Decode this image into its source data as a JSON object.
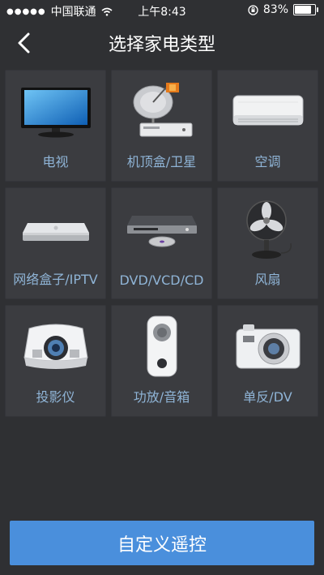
{
  "status": {
    "carrier": "中国联通",
    "time": "上午8:43",
    "battery": "83%"
  },
  "nav": {
    "title": "选择家电类型",
    "back_icon": "chevron-left-icon"
  },
  "devices": [
    {
      "label": "电视",
      "icon": "tv-icon"
    },
    {
      "label": "机顶盒/卫星",
      "icon": "set-top-box-satellite-icon"
    },
    {
      "label": "空调",
      "icon": "air-conditioner-icon"
    },
    {
      "label": "网络盒子/IPTV",
      "icon": "network-box-icon"
    },
    {
      "label": "DVD/VCD/CD",
      "icon": "dvd-player-icon"
    },
    {
      "label": "风扇",
      "icon": "fan-icon"
    },
    {
      "label": "投影仪",
      "icon": "projector-icon"
    },
    {
      "label": "功放/音箱",
      "icon": "speaker-icon"
    },
    {
      "label": "单反/DV",
      "icon": "camera-icon"
    }
  ],
  "footer": {
    "custom_label": "自定义遥控"
  },
  "colors": {
    "background": "#2f3033",
    "tile": "#3b3c40",
    "label": "#8fb4d6",
    "accent_button": "#4a8fdc"
  }
}
